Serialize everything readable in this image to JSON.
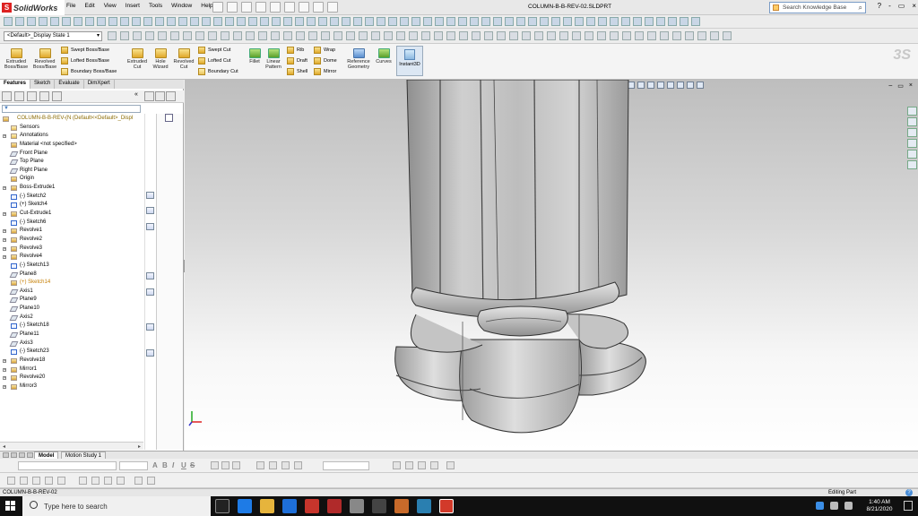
{
  "app": {
    "logo_text": "SolidWorks",
    "menu": [
      "File",
      "Edit",
      "View",
      "Insert",
      "Tools",
      "Window",
      "Help"
    ],
    "document_title": "COLUMN-B-B-REV-02.SLDPRT",
    "search_placeholder": "Search Knowledge Base",
    "window_controls": [
      "?",
      "-",
      "▭",
      "×"
    ]
  },
  "config_dropdown": "<Default>_Display State 1",
  "command_manager": {
    "big_tools": [
      {
        "label": "Extruded Boss/Base"
      },
      {
        "label": "Revolved Boss/Base"
      },
      {
        "label": "Extruded Cut"
      },
      {
        "label": "Hole Wizard"
      },
      {
        "label": "Revolved Cut"
      },
      {
        "label": "Fillet"
      },
      {
        "label": "Linear Pattern"
      },
      {
        "label": "Reference Geometry"
      },
      {
        "label": "Curves"
      }
    ],
    "small_tools": [
      "Swept Boss/Base",
      "Lofted Boss/Base",
      "Boundary Boss/Base",
      "Swept Cut",
      "Lofted Cut",
      "Boundary Cut",
      "Rib",
      "Draft",
      "Shell",
      "Wrap",
      "Dome",
      "Mirror"
    ],
    "instant3d": "Instant3D"
  },
  "panel_tabs": [
    "Features",
    "Sketch",
    "Evaluate",
    "DimXpert"
  ],
  "feature_tree": [
    {
      "label": "COLUMN-B-B-REV-(N  (Default<<Default>_Displ",
      "type": "root"
    },
    {
      "label": "Sensors",
      "type": "fold"
    },
    {
      "label": "Annotations",
      "type": "fold",
      "expand": true
    },
    {
      "label": "Material <not specified>",
      "type": "mat"
    },
    {
      "label": "Front Plane",
      "type": "plane"
    },
    {
      "label": "Top Plane",
      "type": "plane"
    },
    {
      "label": "Right Plane",
      "type": "plane"
    },
    {
      "label": "Origin",
      "type": "origin"
    },
    {
      "label": "Boss-Extrude1",
      "type": "feat",
      "expand": true
    },
    {
      "label": "(-) Sketch2",
      "type": "sk"
    },
    {
      "label": "(+) Sketch4",
      "type": "sk"
    },
    {
      "label": "Cut-Extrude1",
      "type": "feat",
      "expand": true
    },
    {
      "label": "(-) Sketch6",
      "type": "sk"
    },
    {
      "label": "Revolve1",
      "type": "feat",
      "expand": true
    },
    {
      "label": "Revolve2",
      "type": "feat",
      "expand": true
    },
    {
      "label": "Revolve3",
      "type": "feat",
      "expand": true
    },
    {
      "label": "Revolve4",
      "type": "feat",
      "expand": true
    },
    {
      "label": "(-) Sketch13",
      "type": "sk"
    },
    {
      "label": "Plane8",
      "type": "plane"
    },
    {
      "label": "(+) Sketch14",
      "type": "warn"
    },
    {
      "label": "Axis1",
      "type": "axis"
    },
    {
      "label": "Plane9",
      "type": "plane"
    },
    {
      "label": "Plane10",
      "type": "plane"
    },
    {
      "label": "Axis2",
      "type": "axis"
    },
    {
      "label": "(-) Sketch18",
      "type": "sk"
    },
    {
      "label": "Plane11",
      "type": "plane"
    },
    {
      "label": "Axis3",
      "type": "axis"
    },
    {
      "label": "(-) Sketch23",
      "type": "sk"
    },
    {
      "label": "Revolve18",
      "type": "feat",
      "expand": true
    },
    {
      "label": "Mirror1",
      "type": "feat",
      "expand": true
    },
    {
      "label": "Revolve20",
      "type": "feat",
      "expand": true
    },
    {
      "label": "Mirror3",
      "type": "feat",
      "expand": true
    }
  ],
  "bottom_tabs": [
    "Model",
    "Motion Study 1"
  ],
  "status": {
    "left": "COLUMN-B-B-REV-02",
    "right": "Editing Part"
  },
  "taskbar": {
    "search_placeholder": "Type here to search",
    "time": "1:40 AM",
    "date": "8/21/2020"
  },
  "colors": {
    "viewport_top": "#bebebe",
    "viewport_bottom": "#ffffff",
    "model_gray": "#b8b8b8",
    "accent_blue": "#3a78c8"
  }
}
